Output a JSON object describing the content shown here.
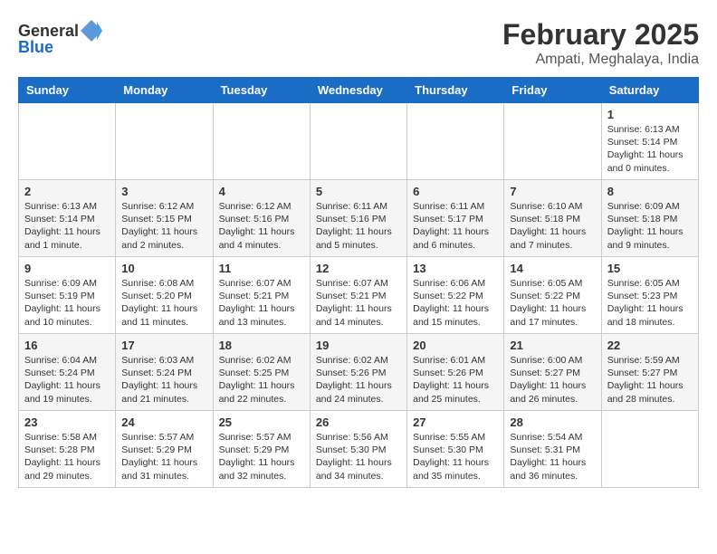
{
  "header": {
    "logo_general": "General",
    "logo_blue": "Blue",
    "month_year": "February 2025",
    "location": "Ampati, Meghalaya, India"
  },
  "days_of_week": [
    "Sunday",
    "Monday",
    "Tuesday",
    "Wednesday",
    "Thursday",
    "Friday",
    "Saturday"
  ],
  "weeks": [
    [
      {
        "day": "",
        "info": ""
      },
      {
        "day": "",
        "info": ""
      },
      {
        "day": "",
        "info": ""
      },
      {
        "day": "",
        "info": ""
      },
      {
        "day": "",
        "info": ""
      },
      {
        "day": "",
        "info": ""
      },
      {
        "day": "1",
        "info": "Sunrise: 6:13 AM\nSunset: 5:14 PM\nDaylight: 11 hours\nand 0 minutes."
      }
    ],
    [
      {
        "day": "2",
        "info": "Sunrise: 6:13 AM\nSunset: 5:14 PM\nDaylight: 11 hours\nand 1 minute."
      },
      {
        "day": "3",
        "info": "Sunrise: 6:12 AM\nSunset: 5:15 PM\nDaylight: 11 hours\nand 2 minutes."
      },
      {
        "day": "4",
        "info": "Sunrise: 6:12 AM\nSunset: 5:16 PM\nDaylight: 11 hours\nand 4 minutes."
      },
      {
        "day": "5",
        "info": "Sunrise: 6:11 AM\nSunset: 5:16 PM\nDaylight: 11 hours\nand 5 minutes."
      },
      {
        "day": "6",
        "info": "Sunrise: 6:11 AM\nSunset: 5:17 PM\nDaylight: 11 hours\nand 6 minutes."
      },
      {
        "day": "7",
        "info": "Sunrise: 6:10 AM\nSunset: 5:18 PM\nDaylight: 11 hours\nand 7 minutes."
      },
      {
        "day": "8",
        "info": "Sunrise: 6:09 AM\nSunset: 5:18 PM\nDaylight: 11 hours\nand 9 minutes."
      }
    ],
    [
      {
        "day": "9",
        "info": "Sunrise: 6:09 AM\nSunset: 5:19 PM\nDaylight: 11 hours\nand 10 minutes."
      },
      {
        "day": "10",
        "info": "Sunrise: 6:08 AM\nSunset: 5:20 PM\nDaylight: 11 hours\nand 11 minutes."
      },
      {
        "day": "11",
        "info": "Sunrise: 6:07 AM\nSunset: 5:21 PM\nDaylight: 11 hours\nand 13 minutes."
      },
      {
        "day": "12",
        "info": "Sunrise: 6:07 AM\nSunset: 5:21 PM\nDaylight: 11 hours\nand 14 minutes."
      },
      {
        "day": "13",
        "info": "Sunrise: 6:06 AM\nSunset: 5:22 PM\nDaylight: 11 hours\nand 15 minutes."
      },
      {
        "day": "14",
        "info": "Sunrise: 6:05 AM\nSunset: 5:22 PM\nDaylight: 11 hours\nand 17 minutes."
      },
      {
        "day": "15",
        "info": "Sunrise: 6:05 AM\nSunset: 5:23 PM\nDaylight: 11 hours\nand 18 minutes."
      }
    ],
    [
      {
        "day": "16",
        "info": "Sunrise: 6:04 AM\nSunset: 5:24 PM\nDaylight: 11 hours\nand 19 minutes."
      },
      {
        "day": "17",
        "info": "Sunrise: 6:03 AM\nSunset: 5:24 PM\nDaylight: 11 hours\nand 21 minutes."
      },
      {
        "day": "18",
        "info": "Sunrise: 6:02 AM\nSunset: 5:25 PM\nDaylight: 11 hours\nand 22 minutes."
      },
      {
        "day": "19",
        "info": "Sunrise: 6:02 AM\nSunset: 5:26 PM\nDaylight: 11 hours\nand 24 minutes."
      },
      {
        "day": "20",
        "info": "Sunrise: 6:01 AM\nSunset: 5:26 PM\nDaylight: 11 hours\nand 25 minutes."
      },
      {
        "day": "21",
        "info": "Sunrise: 6:00 AM\nSunset: 5:27 PM\nDaylight: 11 hours\nand 26 minutes."
      },
      {
        "day": "22",
        "info": "Sunrise: 5:59 AM\nSunset: 5:27 PM\nDaylight: 11 hours\nand 28 minutes."
      }
    ],
    [
      {
        "day": "23",
        "info": "Sunrise: 5:58 AM\nSunset: 5:28 PM\nDaylight: 11 hours\nand 29 minutes."
      },
      {
        "day": "24",
        "info": "Sunrise: 5:57 AM\nSunset: 5:29 PM\nDaylight: 11 hours\nand 31 minutes."
      },
      {
        "day": "25",
        "info": "Sunrise: 5:57 AM\nSunset: 5:29 PM\nDaylight: 11 hours\nand 32 minutes."
      },
      {
        "day": "26",
        "info": "Sunrise: 5:56 AM\nSunset: 5:30 PM\nDaylight: 11 hours\nand 34 minutes."
      },
      {
        "day": "27",
        "info": "Sunrise: 5:55 AM\nSunset: 5:30 PM\nDaylight: 11 hours\nand 35 minutes."
      },
      {
        "day": "28",
        "info": "Sunrise: 5:54 AM\nSunset: 5:31 PM\nDaylight: 11 hours\nand 36 minutes."
      },
      {
        "day": "",
        "info": ""
      }
    ]
  ]
}
